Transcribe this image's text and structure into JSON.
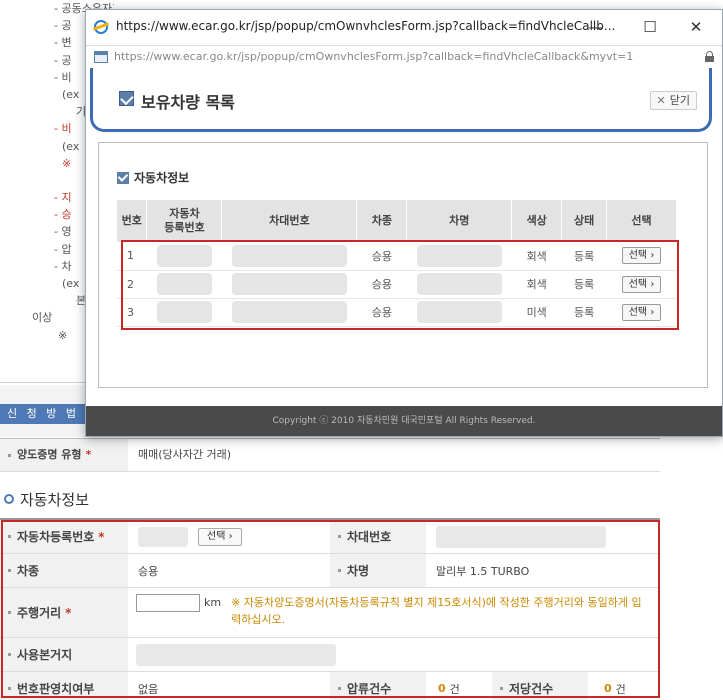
{
  "background": {
    "list_fragments": [
      "- 공동소유자가 있는 차량인 경우",
      "- 공",
      "- 변",
      "- 공",
      "- 비",
      "(ex",
      "기",
      "- 비",
      "(ex",
      "※",
      "",
      "- 지",
      "- 승",
      "- 영",
      "- 압",
      "- 차",
      "(ex",
      "본",
      "이상",
      "※"
    ],
    "apply_tab": "신 청 방 법",
    "doc_type": {
      "label": "양도증명 유형",
      "value": "매매(당사자간 거래)"
    },
    "section_title": "자동차정보",
    "fields": {
      "reg_no_label": "자동차등록번호",
      "select_button": "선택",
      "vin_label": "차대번호",
      "type_label": "차종",
      "type_value": "승용",
      "name_label": "차명",
      "name_value": "말리부 1.5 TURBO",
      "mileage_label": "주행거리",
      "mileage_unit": "km",
      "mileage_notice": "※ 자동차양도증명서(자동차등록규칙 별지 제15호서식)에 작성한 주행거리와 동일하게 입력하십시오.",
      "base_label": "사용본거지",
      "plate_label": "번호판영치여부",
      "plate_value": "없음",
      "seizure_label": "압류건수",
      "seizure_value": "0",
      "mortgage_label": "저당건수",
      "mortgage_value": "0",
      "count_unit": "건",
      "required_mark": "*"
    }
  },
  "popup": {
    "window_title": "https://www.ecar.go.kr/jsp/popup/cmOwnvhclesForm.jsp?callback=findVhcleCallb...",
    "address_url": "https://www.ecar.go.kr/jsp/popup/cmOwnvhclesForm.jsp?callback=findVhcleCallback&myvt=1",
    "page_title": "보유차량 목록",
    "close_label": "닫기",
    "sub_title": "자동차정보",
    "columns": [
      "번호",
      "자동차\n등록번호",
      "차대번호",
      "차종",
      "차명",
      "색상",
      "상태",
      "선택"
    ],
    "col_no": "번호",
    "col_reg_1": "자동차",
    "col_reg_2": "등록번호",
    "col_vin": "차대번호",
    "col_type": "차종",
    "col_name": "차명",
    "col_color": "색상",
    "col_status": "상태",
    "col_select": "선택",
    "rows": [
      {
        "no": "1",
        "type": "승용",
        "color": "회색",
        "status": "등록",
        "action": "선택 ›"
      },
      {
        "no": "2",
        "type": "승용",
        "color": "회색",
        "status": "등록",
        "action": "선택 ›"
      },
      {
        "no": "3",
        "type": "승용",
        "color": "미색",
        "status": "등록",
        "action": "선택 ›"
      }
    ],
    "footer": "Copyright ⓒ 2010 자동차민원 대국민포털  All Rights Reserved."
  },
  "colors": {
    "accent": "#3d6bb3",
    "highlight": "#c62828",
    "notice": "#c98a00"
  }
}
